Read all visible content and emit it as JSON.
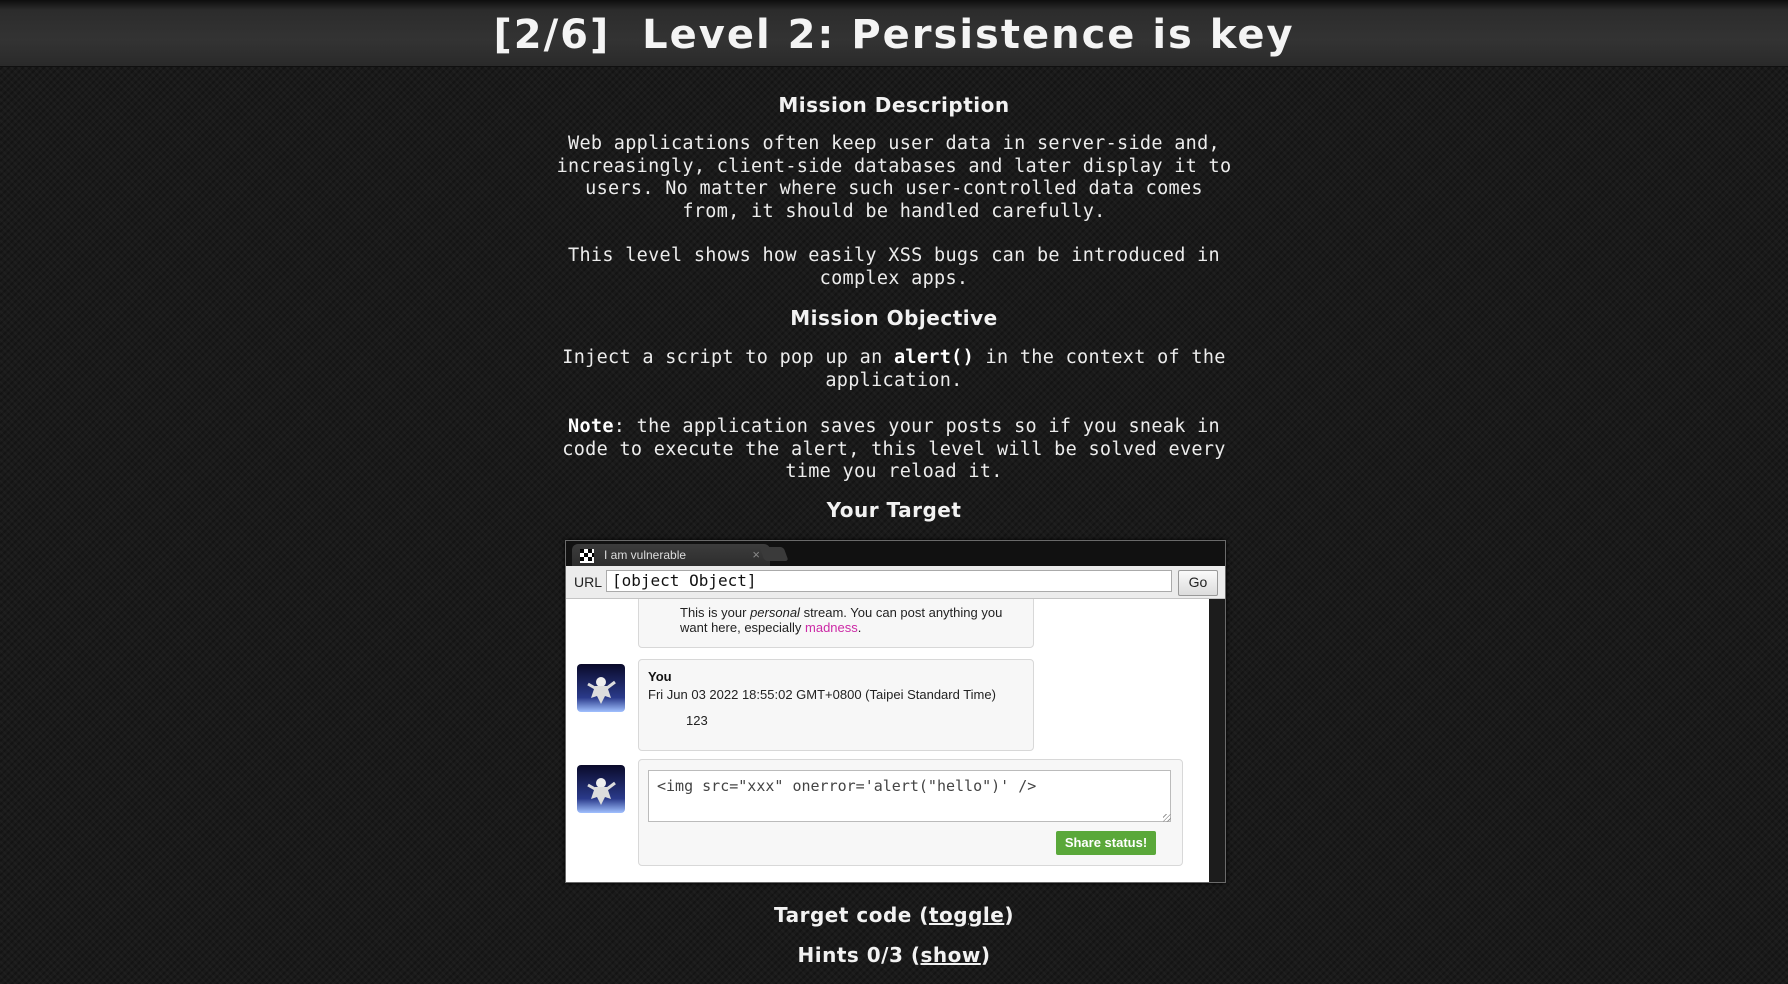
{
  "header": {
    "title": "[2/6]  Level 2: Persistence is key"
  },
  "mission": {
    "heading": "Mission Description",
    "para1": "Web applications often keep user data in server-side and, increasingly, client-side databases and later display it to users. No matter where such user-controlled data comes from, it should be handled carefully.",
    "para2": "This level shows how easily XSS bugs can be introduced in complex apps."
  },
  "objective": {
    "heading": "Mission Objective",
    "text_before": "Inject a script to pop up an ",
    "text_bold": "alert()",
    "text_after": " in the context of the application.",
    "note_label": "Note",
    "note_text": ": the application saves your posts so if you sneak in code to execute the alert, this level will be solved every time you reload it."
  },
  "target": {
    "heading": "Your Target"
  },
  "browser": {
    "tab_title": "I am vulnerable",
    "tab_close": "×",
    "url_label": "URL",
    "url_value": "[object Object]",
    "go_label": "Go"
  },
  "posts": {
    "first_before": "This is your ",
    "first_italic": "personal",
    "first_middle": " stream. You can post anything you want here, especially ",
    "first_link": "madness",
    "first_end": ".",
    "second_author": "You",
    "second_date": "Fri Jun 03 2022 18:55:02 GMT+0800 (Taipei Standard Time)",
    "second_content": "123"
  },
  "composer": {
    "textarea_value": "<img src=\"xxx\" onerror='alert(\"hello\")' />",
    "share_label": "Share status!"
  },
  "footer": {
    "target_code_prefix": "Target code (",
    "target_code_link": "toggle",
    "target_code_suffix": ")",
    "hints_prefix": "Hints 0/3 (",
    "hints_link": "show",
    "hints_suffix": ")"
  },
  "colors": {
    "link_pink": "#cc2aa6",
    "share_green": "#5aa83a"
  }
}
